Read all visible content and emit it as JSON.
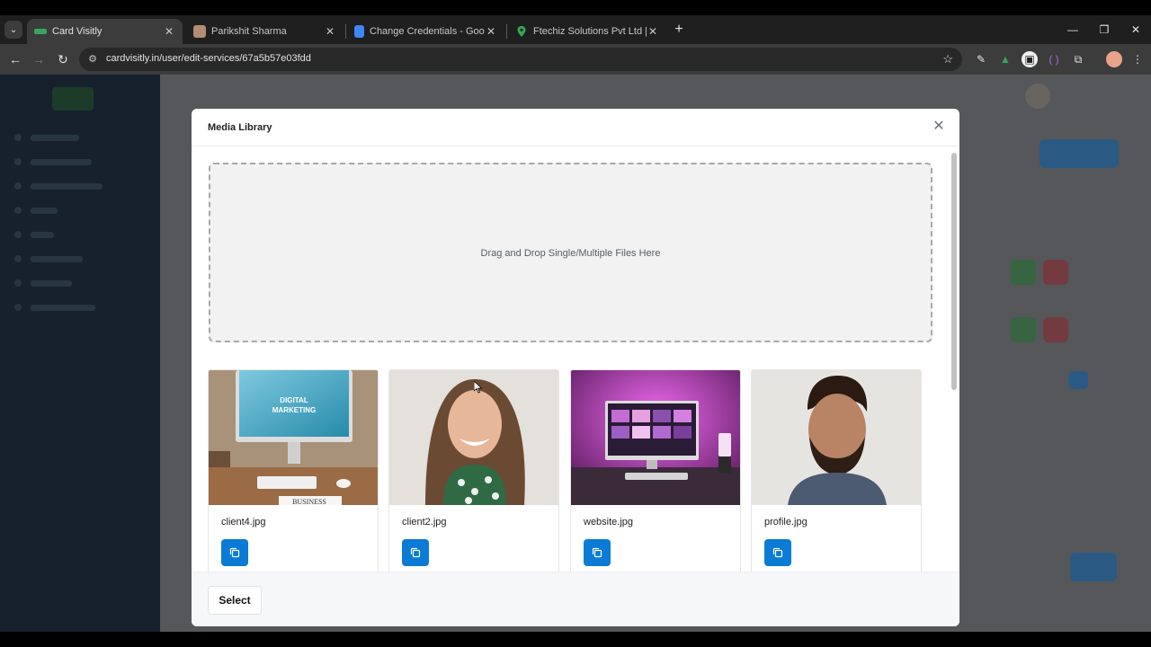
{
  "browser": {
    "tabs": [
      {
        "title": "Card Visitly",
        "active": true,
        "favicon_color": "#3aa55d"
      },
      {
        "title": "Parikshit Sharma",
        "active": false,
        "favicon_color": "#b08d74"
      },
      {
        "title": "Change Credentials - Google Docs",
        "active": false,
        "favicon_color": "#4285f4"
      },
      {
        "title": "Ftechiz Solutions Pvt Ltd | Best",
        "active": false,
        "favicon_color": "#34a853"
      }
    ],
    "new_tab_glyph": "+",
    "close_glyph": "✕",
    "url": "cardvisitly.in/user/edit-services/67a5b57e03fdd",
    "window_controls": {
      "minimize": "—",
      "restore": "❐",
      "close": "✕"
    }
  },
  "modal": {
    "title": "Media Library",
    "close_glyph": "✕",
    "dropzone_text": "Drag and Drop Single/Multiple Files Here",
    "files": [
      {
        "name": "client4.jpg",
        "thumb_text_1": "DIGITAL",
        "thumb_text_2": "MARKETING",
        "thumb_text_3": "BUSINESS"
      },
      {
        "name": "client2.jpg"
      },
      {
        "name": "website.jpg"
      },
      {
        "name": "profile.jpg"
      }
    ],
    "select_label": "Select"
  },
  "colors": {
    "primary_button": "#0b7bd6",
    "sidebar_bg": "#182330"
  }
}
